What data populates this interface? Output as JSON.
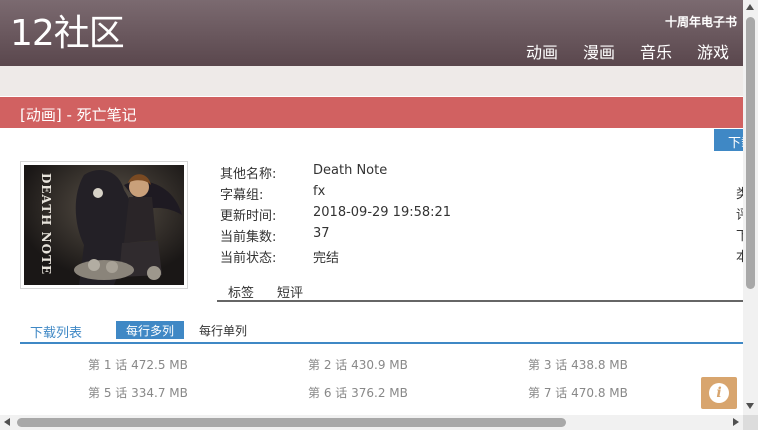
{
  "header": {
    "logo": "12社区",
    "promo": "十周年电子书",
    "nav": [
      "动画",
      "漫画",
      "音乐",
      "游戏"
    ]
  },
  "title": "[动画] - 死亡笔记",
  "download_tab": "下载",
  "cover_text": "DEATH NOTE",
  "info": [
    {
      "label": "其他名称:",
      "value": "Death Note"
    },
    {
      "label": "字幕组:",
      "value": "fx"
    },
    {
      "label": "更新时间:",
      "value": "2018-09-29 19:58:21"
    },
    {
      "label": "当前集数:",
      "value": "37"
    },
    {
      "label": "当前状态:",
      "value": "完结"
    }
  ],
  "right_column": [
    "类",
    "评",
    "下",
    "本"
  ],
  "subtabs": [
    "标签",
    "短评"
  ],
  "download_list": {
    "title": "下载列表",
    "mode_multi": "每行多列",
    "mode_single": "每行单列"
  },
  "episodes": [
    [
      {
        "label": "第 1 话",
        "size": "472.5 MB"
      },
      {
        "label": "第 2 话",
        "size": "430.9 MB"
      },
      {
        "label": "第 3 话",
        "size": "438.8 MB"
      }
    ],
    [
      {
        "label": "第 5 话",
        "size": "334.7 MB"
      },
      {
        "label": "第 6 话",
        "size": "376.2 MB"
      },
      {
        "label": "第 7 话",
        "size": "470.8 MB"
      }
    ]
  ],
  "info_button_glyph": "i",
  "colors": {
    "header": "#6b595f",
    "title_bar": "#d16161",
    "accent": "#3f88c5",
    "info_button": "#d8a56e"
  }
}
